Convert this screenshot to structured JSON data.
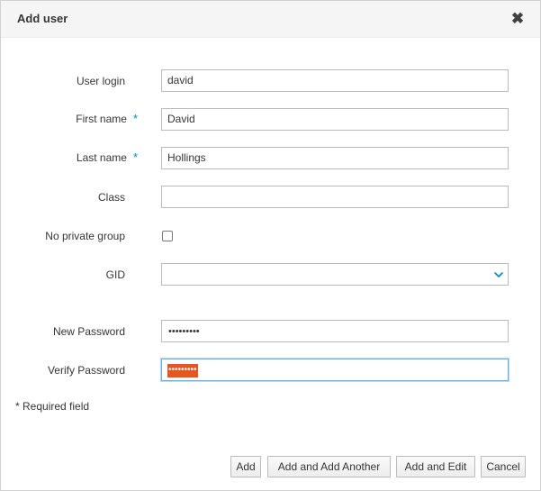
{
  "dialog": {
    "title": "Add user",
    "close_glyph": "✖"
  },
  "form": {
    "required_marker": "*",
    "user_login": {
      "label": "User login",
      "value": "david"
    },
    "first_name": {
      "label": "First name",
      "value": "David",
      "required": true
    },
    "last_name": {
      "label": "Last name",
      "value": "Hollings",
      "required": true
    },
    "class": {
      "label": "Class",
      "value": ""
    },
    "no_private_group": {
      "label": "No private group",
      "checked": false
    },
    "gid": {
      "label": "GID",
      "value": ""
    },
    "new_password": {
      "label": "New Password",
      "value": "•••••••••"
    },
    "verify_password": {
      "label": "Verify Password",
      "value": "•••••••••",
      "state": "focused, text selected"
    }
  },
  "required_note": "* Required field",
  "buttons": {
    "add": "Add",
    "add_another": "Add and Add Another",
    "add_edit": "Add and Edit",
    "cancel": "Cancel"
  },
  "colors": {
    "required_star": "#0088ce",
    "focus_border": "#66afe9",
    "selection": "#e8551f"
  },
  "icons": {
    "close": "close-icon",
    "dropdown": "chevron-down-icon"
  }
}
